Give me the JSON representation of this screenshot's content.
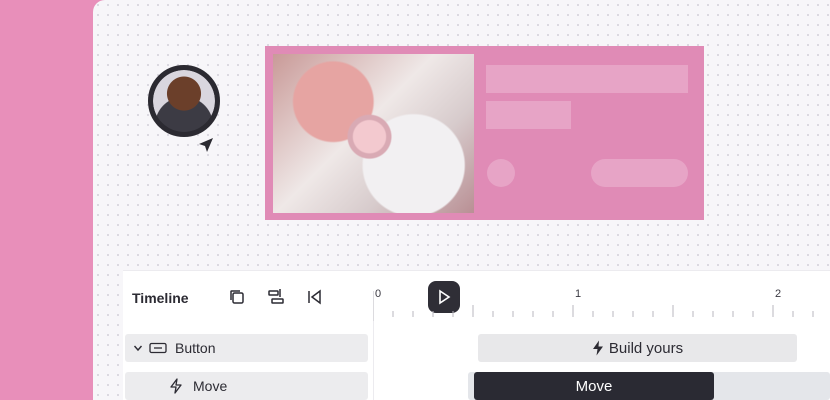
{
  "timeline": {
    "title": "Timeline",
    "tools": [
      {
        "icon": "duplicate-icon"
      },
      {
        "icon": "align-icon"
      },
      {
        "icon": "skip-to-start-icon"
      },
      {
        "icon": "play-icon",
        "active": true
      }
    ],
    "ruler_labels": [
      "0",
      "1",
      "2"
    ],
    "tracks": [
      {
        "label": "Button",
        "icon": "button-element-icon",
        "expand_icon": "chevron-down-icon"
      },
      {
        "label": "Move",
        "icon": "bolt-icon"
      }
    ],
    "clips": {
      "build_yours": {
        "label": "Build yours",
        "icon": "bolt-icon"
      },
      "move": {
        "label": "Move"
      }
    }
  },
  "colors": {
    "brand_pink": "#e88fba",
    "card_pink": "#e08bb6",
    "dark": "#2f2e36"
  }
}
